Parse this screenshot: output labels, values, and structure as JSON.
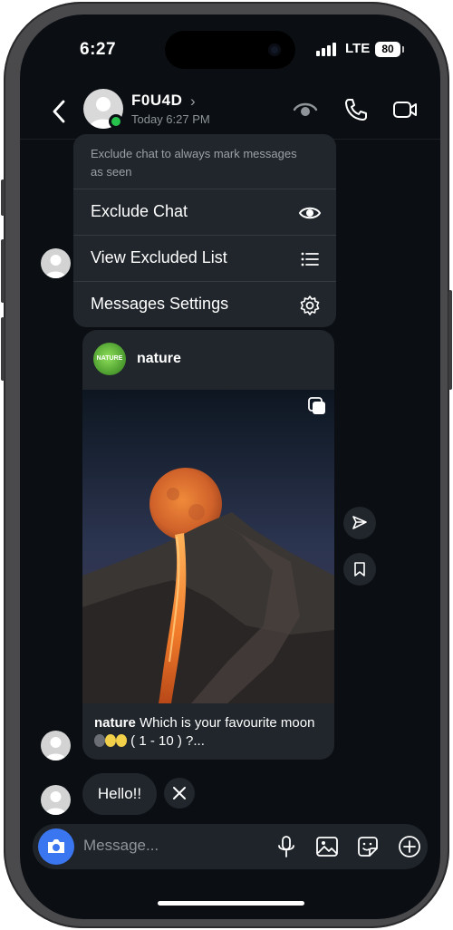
{
  "status_bar": {
    "time": "6:27",
    "network": "LTE",
    "battery": "80"
  },
  "header": {
    "contact_name": "F0U4D",
    "subtitle": "Today 6:27 PM"
  },
  "menu": {
    "note": "Exclude chat to always mark messages as seen",
    "items": [
      {
        "label": "Exclude Chat",
        "icon": "eye-icon"
      },
      {
        "label": "View Excluded List",
        "icon": "list-icon"
      },
      {
        "label": "Messages Settings",
        "icon": "gear-icon"
      }
    ]
  },
  "post": {
    "account": "nature",
    "logo_text": "NATURE",
    "caption_user": "nature",
    "caption_text_1": "Which is your favourite moon",
    "caption_text_2": "( 1 - 10 ) ?..."
  },
  "messages": [
    {
      "text": "Hello!!"
    }
  ],
  "composer": {
    "placeholder": "Message..."
  },
  "colors": {
    "background": "#0b0f13",
    "bubble": "#20262c",
    "accent": "#3a76f0",
    "online": "#27c24c"
  }
}
